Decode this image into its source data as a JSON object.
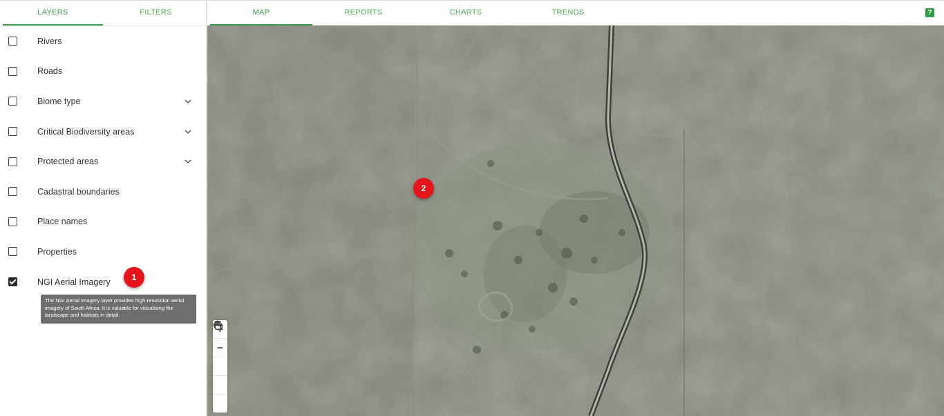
{
  "sidebar": {
    "tabs": [
      {
        "label": "LAYERS",
        "active": true
      },
      {
        "label": "FILTERS",
        "active": false
      }
    ],
    "layers": [
      {
        "label": "Rivers",
        "checked": false,
        "expandable": false
      },
      {
        "label": "Roads",
        "checked": false,
        "expandable": false
      },
      {
        "label": "Biome type",
        "checked": false,
        "expandable": true
      },
      {
        "label": "Critical Biodiversity areas",
        "checked": false,
        "expandable": true
      },
      {
        "label": "Protected areas",
        "checked": false,
        "expandable": true
      },
      {
        "label": "Cadastral boundaries",
        "checked": false,
        "expandable": false
      },
      {
        "label": "Place names",
        "checked": false,
        "expandable": false
      },
      {
        "label": "Properties",
        "checked": false,
        "expandable": false
      },
      {
        "label": "NGI Aerial Imagery",
        "checked": true,
        "expandable": false
      }
    ],
    "tooltip": "The NGI Aerial Imagery layer provides high-resolution aerial imagery of South Africa. It is valuable for visualising the landscape and habitats in detail."
  },
  "topnav": {
    "tabs": [
      {
        "label": "MAP",
        "active": true
      },
      {
        "label": "REPORTS",
        "active": false
      },
      {
        "label": "CHARTS",
        "active": false
      },
      {
        "label": "TRENDS",
        "active": false
      }
    ],
    "help_label": "?"
  },
  "markers": [
    {
      "label": "1"
    },
    {
      "label": "2"
    }
  ],
  "map_controls": {
    "zoom_in": "+",
    "zoom_out": "−",
    "three_d": "3D"
  },
  "colors": {
    "accent": "#3b9b4a",
    "badge": "#e6141b",
    "map_base": "#7d8176"
  }
}
